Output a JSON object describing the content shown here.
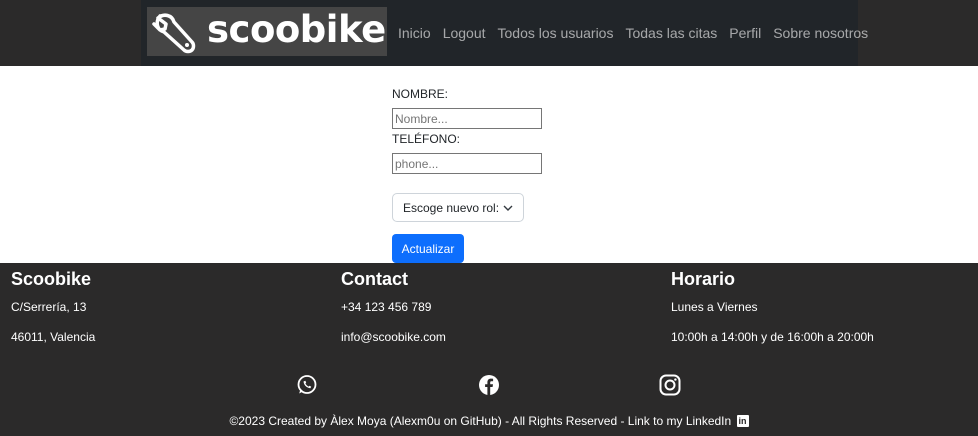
{
  "header": {
    "brand": "scoobike",
    "nav": [
      "Inicio",
      "Logout",
      "Todos los usuarios",
      "Todas las citas",
      "Perfil",
      "Sobre nosotros"
    ]
  },
  "form": {
    "name_label": "NOMBRE:",
    "name_placeholder": "Nombre...",
    "phone_label": "TELÉFONO:",
    "phone_placeholder": "phone...",
    "role_select": "Escoge nuevo rol:",
    "submit_label": "Actualizar"
  },
  "footer": {
    "col1": {
      "title": "Scoobike",
      "lines": [
        "C/Serrería, 13",
        "46011, Valencia"
      ]
    },
    "col2": {
      "title": "Contact",
      "lines": [
        "+34 123 456 789",
        "info@scoobike.com"
      ]
    },
    "col3": {
      "title": "Horario",
      "lines": [
        "Lunes a Viernes",
        "10:00h a 14:00h y de 16:00h a 20:00h"
      ]
    },
    "social": [
      "whatsapp-icon",
      "facebook-icon",
      "instagram-icon"
    ],
    "copyright": "©2023 Created by Àlex Moya (Alexm0u on GitHub) - All Rights Reserved - Link to my LinkedIn",
    "linkedin_badge": "in"
  }
}
